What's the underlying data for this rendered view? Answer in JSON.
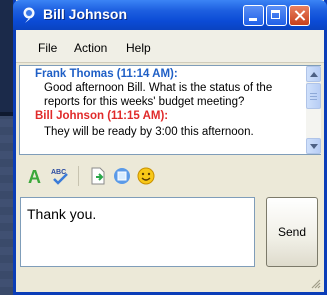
{
  "window": {
    "title": "Bill Johnson",
    "title_icon": "contact-icon",
    "controls": [
      "minimize",
      "maximize",
      "close"
    ],
    "accent_color": "#0a4bd6"
  },
  "menu": {
    "items": [
      "File",
      "Action",
      "Help"
    ]
  },
  "conversation": {
    "messages": [
      {
        "sender": "Frank Thomas (11:14 AM):",
        "color": "#1f5fc6",
        "lines": [
          "Good afternoon Bill. What is the status of the",
          "reports for this weeks' budget meeting?"
        ]
      },
      {
        "sender": "Bill Johnson (11:15 AM):",
        "color": "#e02a2a",
        "lines": [
          "They will be ready by 3:00 this afternoon."
        ]
      }
    ]
  },
  "toolbar": {
    "icons": [
      "font-icon",
      "spellcheck-icon",
      "send-file-icon",
      "photo-icon",
      "emoticon-icon"
    ]
  },
  "compose": {
    "value": "Thank you.",
    "send_label": "Send"
  }
}
